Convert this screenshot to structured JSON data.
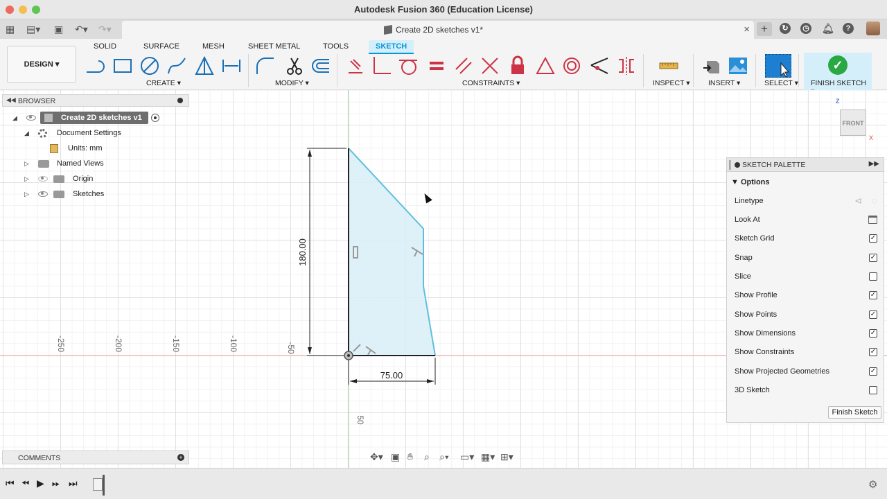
{
  "window": {
    "title": "Autodesk Fusion 360 (Education License)"
  },
  "document_tab": {
    "title": "Create 2D sketches v1*",
    "close": "×"
  },
  "toolbar": {
    "workspace": "DESIGN ▾",
    "tabs": [
      "SOLID",
      "SURFACE",
      "MESH",
      "SHEET METAL",
      "TOOLS",
      "SKETCH"
    ],
    "groups": {
      "create": "CREATE ▾",
      "modify": "MODIFY ▾",
      "constraints": "CONSTRAINTS ▾",
      "inspect": "INSPECT ▾",
      "insert": "INSERT ▾",
      "select": "SELECT ▾",
      "finish": "FINISH SKETCH ▾"
    }
  },
  "browser": {
    "title": "BROWSER",
    "root": "Create 2D sketches v1",
    "items": {
      "document_settings": "Document Settings",
      "units": "Units: mm",
      "named_views": "Named Views",
      "origin": "Origin",
      "sketches": "Sketches"
    }
  },
  "comments": {
    "title": "COMMENTS"
  },
  "sketch": {
    "dimension_vertical": "180.00",
    "dimension_horizontal": "75.00",
    "ruler_labels": [
      "-250",
      "-200",
      "-150",
      "-100",
      "-50",
      "50"
    ]
  },
  "viewcube": {
    "face": "FRONT",
    "z_axis": "Z",
    "x_axis": "X"
  },
  "sketch_palette": {
    "title": "SKETCH PALETTE",
    "section": "Options",
    "options": [
      {
        "label": "Linetype",
        "control": "icon"
      },
      {
        "label": "Look At",
        "control": "icon"
      },
      {
        "label": "Sketch Grid",
        "checked": true
      },
      {
        "label": "Snap",
        "checked": true
      },
      {
        "label": "Slice",
        "checked": false
      },
      {
        "label": "Show Profile",
        "checked": true
      },
      {
        "label": "Show Points",
        "checked": true
      },
      {
        "label": "Show Dimensions",
        "checked": true
      },
      {
        "label": "Show Constraints",
        "checked": true
      },
      {
        "label": "Show Projected Geometries",
        "checked": true
      },
      {
        "label": "3D Sketch",
        "checked": false
      }
    ],
    "finish_button": "Finish Sketch"
  },
  "colors": {
    "accent": "#0696d7",
    "profile_fill": "#d9eef7",
    "sketch_line": "#5bc0de",
    "finish_green": "#2aa843"
  }
}
